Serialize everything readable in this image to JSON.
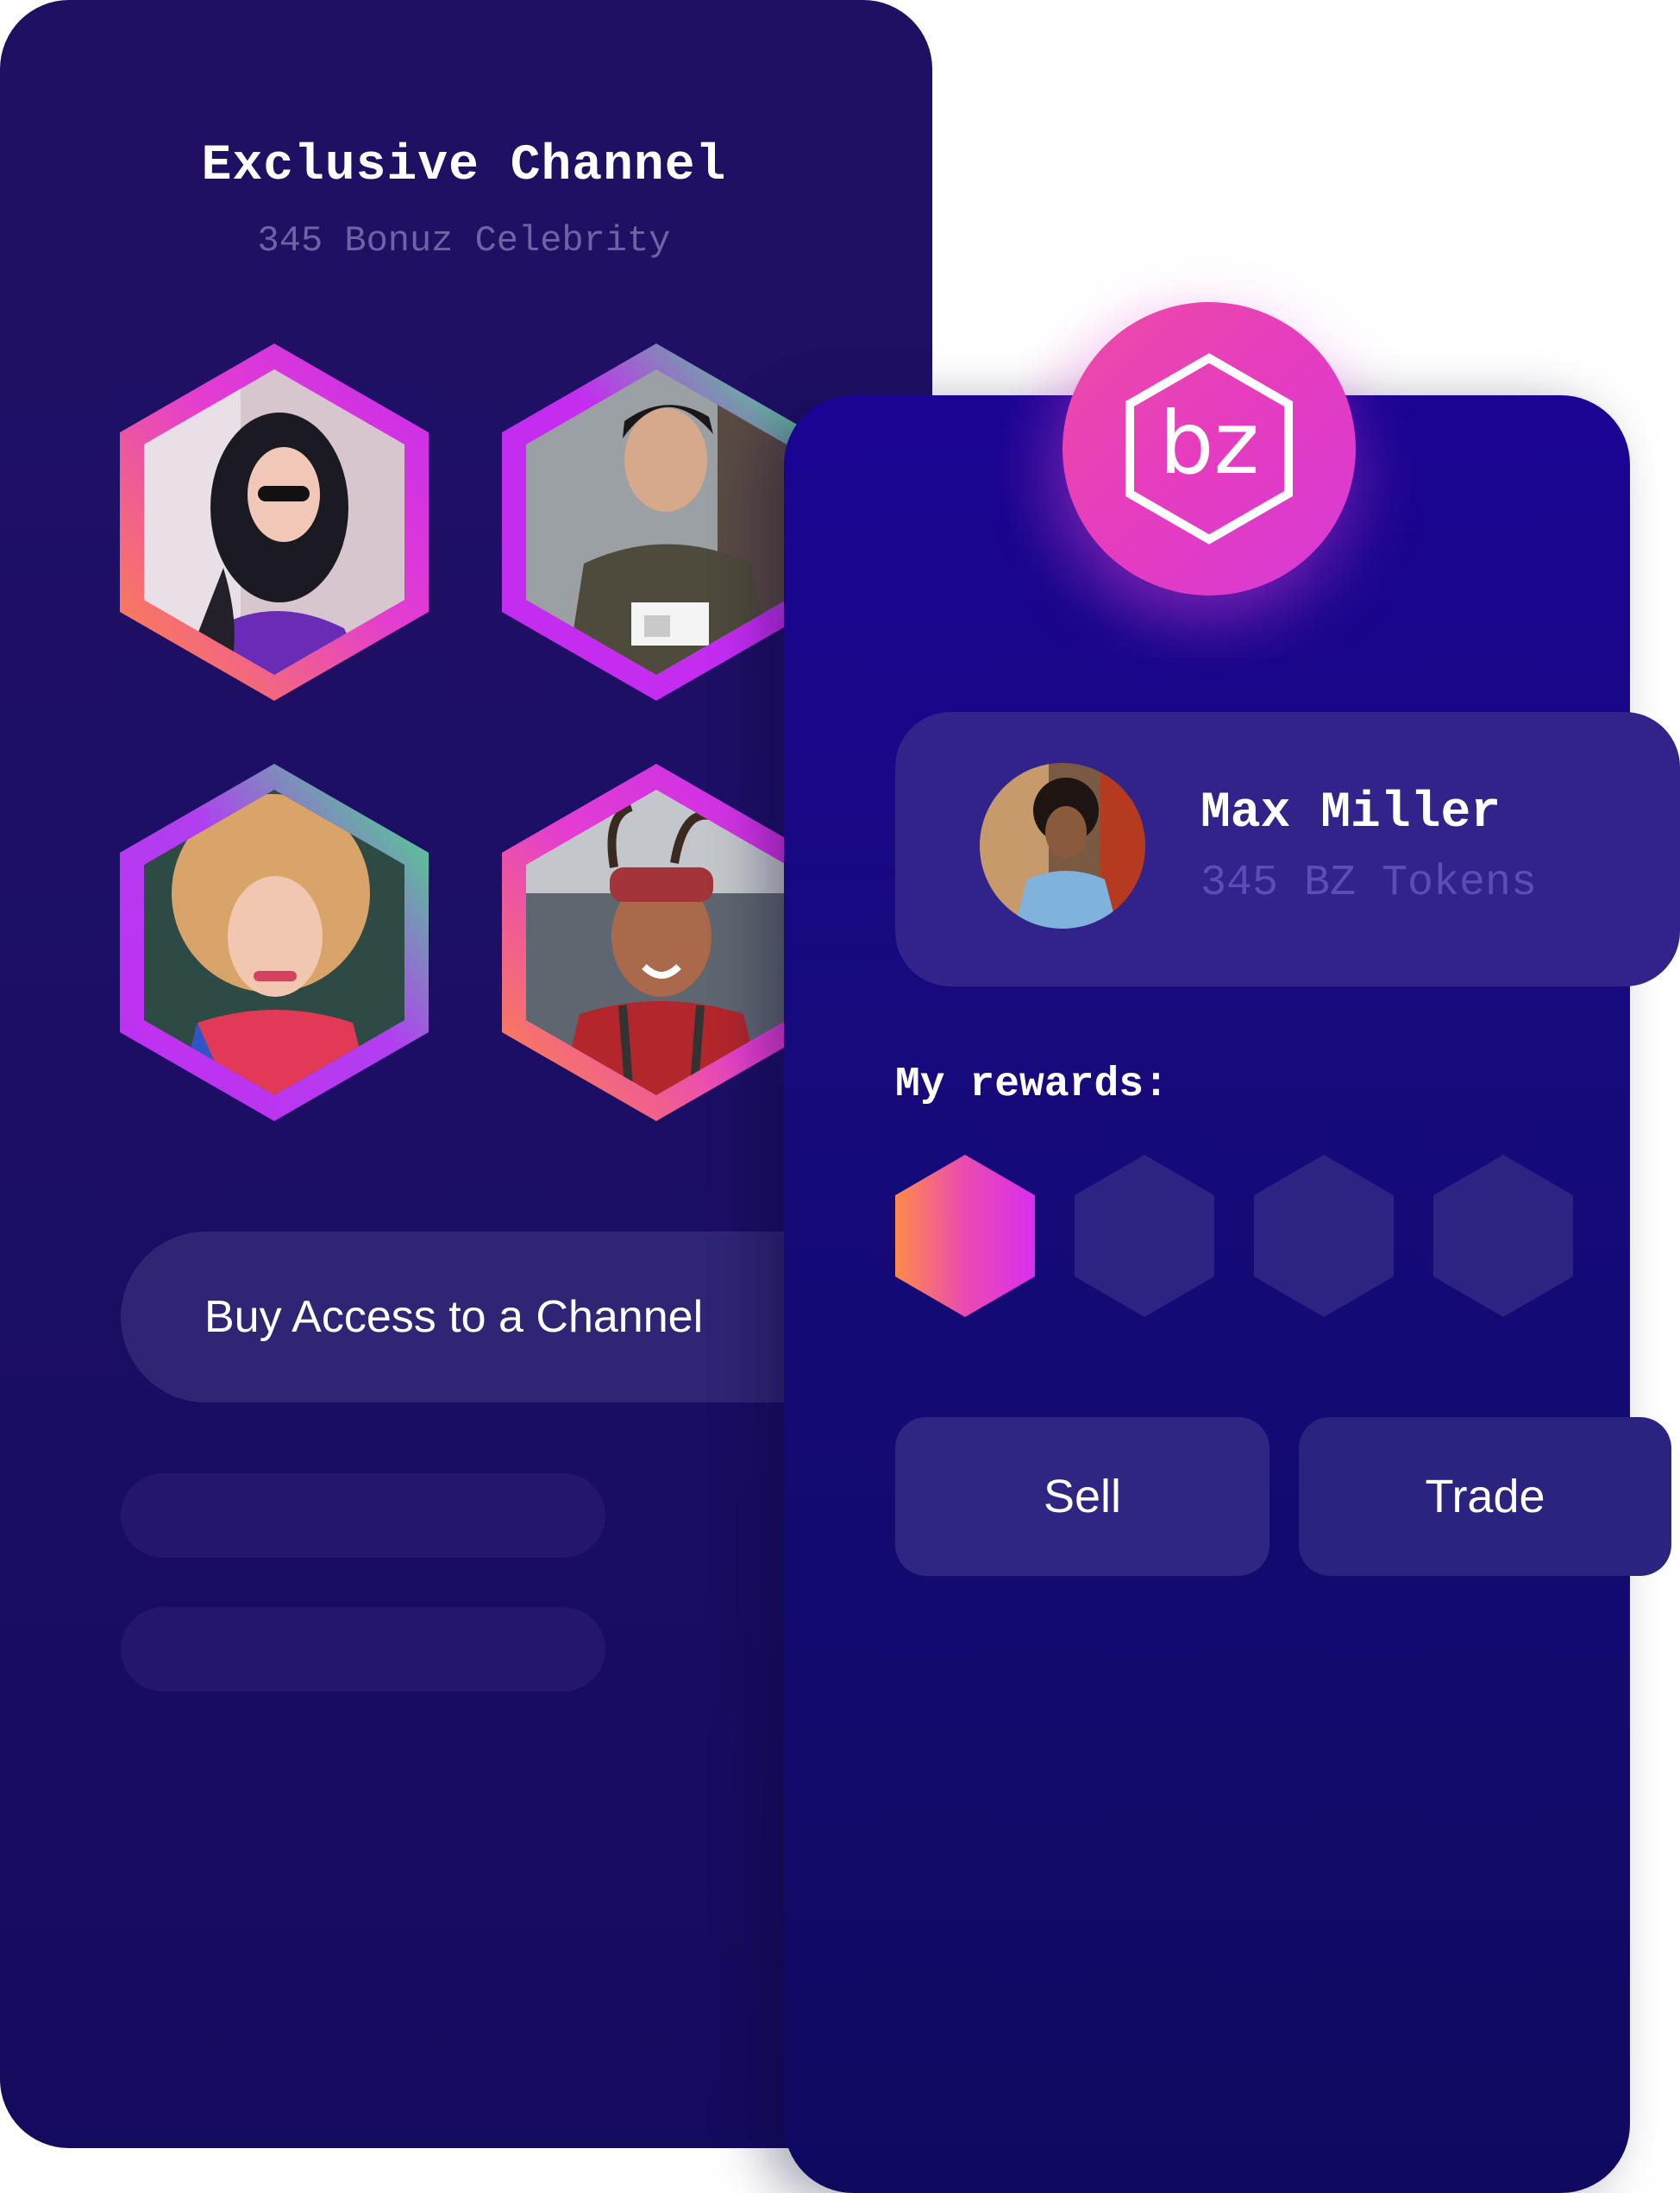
{
  "channel": {
    "title": "Exclusive Channel",
    "subtitle": "345 Bonuz Celebrity",
    "buy_button_label": "Buy Access to a Channel",
    "avatars": [
      {
        "name": "celebrity-1",
        "ring_colors": [
          "#ff8a3d",
          "#c42cf0"
        ]
      },
      {
        "name": "celebrity-2",
        "ring_colors": [
          "#3cf07a",
          "#c42cf0"
        ]
      },
      {
        "name": "celebrity-3",
        "ring_colors": [
          "#3cf07a",
          "#c42cf0"
        ]
      },
      {
        "name": "celebrity-4",
        "ring_colors": [
          "#ff8a3d",
          "#e43dd0"
        ]
      }
    ]
  },
  "logo": {
    "text": "bz",
    "colors": [
      "#f04ba6",
      "#d63ad6"
    ]
  },
  "profile": {
    "name": "Max Miller",
    "tokens": "345 BZ Tokens"
  },
  "rewards": {
    "heading": "My rewards:",
    "slots": [
      {
        "filled": true,
        "colors": [
          "#ff8a4a",
          "#d92ef0"
        ]
      },
      {
        "filled": false
      },
      {
        "filled": false
      },
      {
        "filled": false
      }
    ]
  },
  "actions": {
    "sell_label": "Sell",
    "trade_label": "Trade"
  },
  "colors": {
    "card_back": "#201063",
    "card_front": "#1b0494",
    "accent_pink": "#e53cc0",
    "muted_text": "#6f63a3"
  }
}
